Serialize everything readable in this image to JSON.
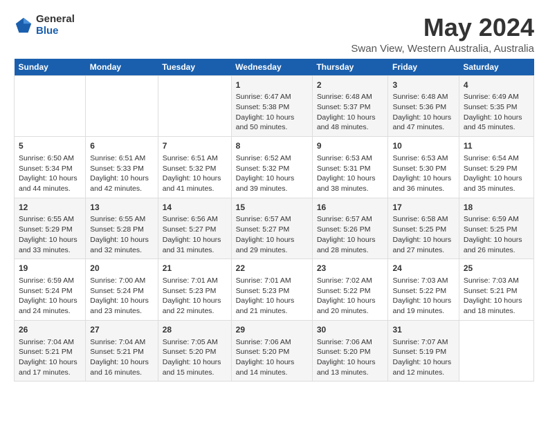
{
  "header": {
    "logo": {
      "general": "General",
      "blue": "Blue"
    },
    "title": "May 2024",
    "subtitle": "Swan View, Western Australia, Australia"
  },
  "calendar": {
    "days_of_week": [
      "Sunday",
      "Monday",
      "Tuesday",
      "Wednesday",
      "Thursday",
      "Friday",
      "Saturday"
    ],
    "weeks": [
      [
        {
          "day": "",
          "content": ""
        },
        {
          "day": "",
          "content": ""
        },
        {
          "day": "",
          "content": ""
        },
        {
          "day": "1",
          "content": "Sunrise: 6:47 AM\nSunset: 5:38 PM\nDaylight: 10 hours and 50 minutes."
        },
        {
          "day": "2",
          "content": "Sunrise: 6:48 AM\nSunset: 5:37 PM\nDaylight: 10 hours and 48 minutes."
        },
        {
          "day": "3",
          "content": "Sunrise: 6:48 AM\nSunset: 5:36 PM\nDaylight: 10 hours and 47 minutes."
        },
        {
          "day": "4",
          "content": "Sunrise: 6:49 AM\nSunset: 5:35 PM\nDaylight: 10 hours and 45 minutes."
        }
      ],
      [
        {
          "day": "5",
          "content": "Sunrise: 6:50 AM\nSunset: 5:34 PM\nDaylight: 10 hours and 44 minutes."
        },
        {
          "day": "6",
          "content": "Sunrise: 6:51 AM\nSunset: 5:33 PM\nDaylight: 10 hours and 42 minutes."
        },
        {
          "day": "7",
          "content": "Sunrise: 6:51 AM\nSunset: 5:32 PM\nDaylight: 10 hours and 41 minutes."
        },
        {
          "day": "8",
          "content": "Sunrise: 6:52 AM\nSunset: 5:32 PM\nDaylight: 10 hours and 39 minutes."
        },
        {
          "day": "9",
          "content": "Sunrise: 6:53 AM\nSunset: 5:31 PM\nDaylight: 10 hours and 38 minutes."
        },
        {
          "day": "10",
          "content": "Sunrise: 6:53 AM\nSunset: 5:30 PM\nDaylight: 10 hours and 36 minutes."
        },
        {
          "day": "11",
          "content": "Sunrise: 6:54 AM\nSunset: 5:29 PM\nDaylight: 10 hours and 35 minutes."
        }
      ],
      [
        {
          "day": "12",
          "content": "Sunrise: 6:55 AM\nSunset: 5:29 PM\nDaylight: 10 hours and 33 minutes."
        },
        {
          "day": "13",
          "content": "Sunrise: 6:55 AM\nSunset: 5:28 PM\nDaylight: 10 hours and 32 minutes."
        },
        {
          "day": "14",
          "content": "Sunrise: 6:56 AM\nSunset: 5:27 PM\nDaylight: 10 hours and 31 minutes."
        },
        {
          "day": "15",
          "content": "Sunrise: 6:57 AM\nSunset: 5:27 PM\nDaylight: 10 hours and 29 minutes."
        },
        {
          "day": "16",
          "content": "Sunrise: 6:57 AM\nSunset: 5:26 PM\nDaylight: 10 hours and 28 minutes."
        },
        {
          "day": "17",
          "content": "Sunrise: 6:58 AM\nSunset: 5:25 PM\nDaylight: 10 hours and 27 minutes."
        },
        {
          "day": "18",
          "content": "Sunrise: 6:59 AM\nSunset: 5:25 PM\nDaylight: 10 hours and 26 minutes."
        }
      ],
      [
        {
          "day": "19",
          "content": "Sunrise: 6:59 AM\nSunset: 5:24 PM\nDaylight: 10 hours and 24 minutes."
        },
        {
          "day": "20",
          "content": "Sunrise: 7:00 AM\nSunset: 5:24 PM\nDaylight: 10 hours and 23 minutes."
        },
        {
          "day": "21",
          "content": "Sunrise: 7:01 AM\nSunset: 5:23 PM\nDaylight: 10 hours and 22 minutes."
        },
        {
          "day": "22",
          "content": "Sunrise: 7:01 AM\nSunset: 5:23 PM\nDaylight: 10 hours and 21 minutes."
        },
        {
          "day": "23",
          "content": "Sunrise: 7:02 AM\nSunset: 5:22 PM\nDaylight: 10 hours and 20 minutes."
        },
        {
          "day": "24",
          "content": "Sunrise: 7:03 AM\nSunset: 5:22 PM\nDaylight: 10 hours and 19 minutes."
        },
        {
          "day": "25",
          "content": "Sunrise: 7:03 AM\nSunset: 5:21 PM\nDaylight: 10 hours and 18 minutes."
        }
      ],
      [
        {
          "day": "26",
          "content": "Sunrise: 7:04 AM\nSunset: 5:21 PM\nDaylight: 10 hours and 17 minutes."
        },
        {
          "day": "27",
          "content": "Sunrise: 7:04 AM\nSunset: 5:21 PM\nDaylight: 10 hours and 16 minutes."
        },
        {
          "day": "28",
          "content": "Sunrise: 7:05 AM\nSunset: 5:20 PM\nDaylight: 10 hours and 15 minutes."
        },
        {
          "day": "29",
          "content": "Sunrise: 7:06 AM\nSunset: 5:20 PM\nDaylight: 10 hours and 14 minutes."
        },
        {
          "day": "30",
          "content": "Sunrise: 7:06 AM\nSunset: 5:20 PM\nDaylight: 10 hours and 13 minutes."
        },
        {
          "day": "31",
          "content": "Sunrise: 7:07 AM\nSunset: 5:19 PM\nDaylight: 10 hours and 12 minutes."
        },
        {
          "day": "",
          "content": ""
        }
      ]
    ]
  }
}
